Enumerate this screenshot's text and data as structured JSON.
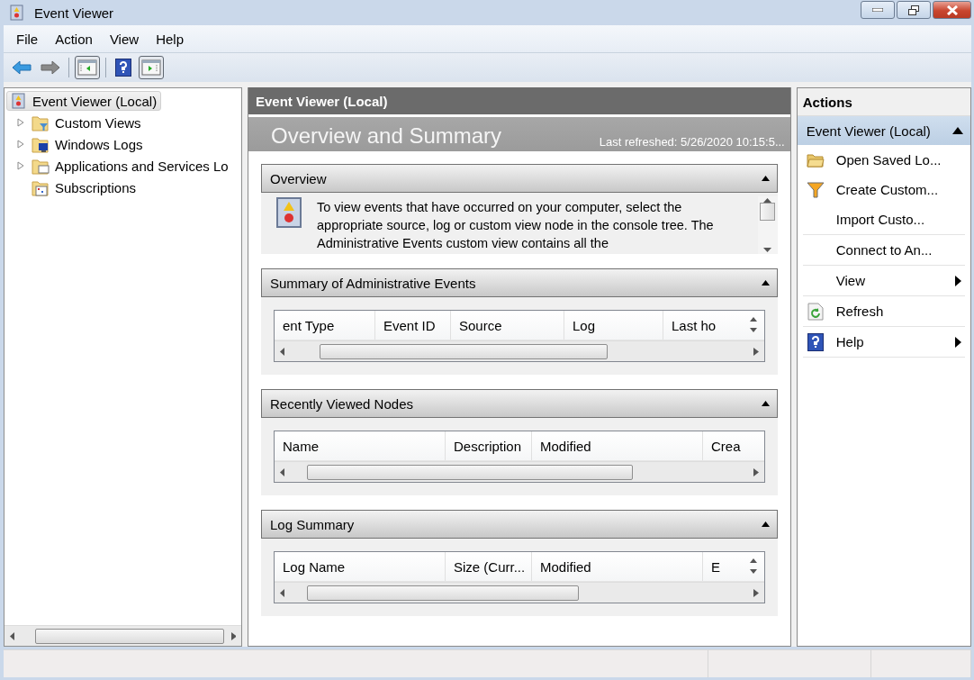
{
  "window": {
    "title": "Event Viewer"
  },
  "menu": [
    {
      "label": "File"
    },
    {
      "label": "Action"
    },
    {
      "label": "View"
    },
    {
      "label": "Help"
    }
  ],
  "tree": {
    "label": "Event Viewer (Local)",
    "selected": true,
    "children": [
      {
        "label": "Custom Views",
        "kind": "filter-folder",
        "expandable": true
      },
      {
        "label": "Windows Logs",
        "kind": "monitor-folder",
        "expandable": true
      },
      {
        "label": "Applications and Services Lo",
        "kind": "window-folder",
        "expandable": true
      },
      {
        "label": "Subscriptions",
        "kind": "calendar",
        "expandable": false
      }
    ]
  },
  "center": {
    "header": "Event Viewer (Local)",
    "banner_title": "Overview and Summary",
    "refreshed": "Last refreshed: 5/26/2020 10:15:5...",
    "sections": [
      {
        "title": "Overview",
        "expanded": true,
        "kind": "text",
        "text": "To view events that have occurred on your computer, select the appropriate source, log or custom view node in the console tree. The Administrative Events custom view contains all the"
      },
      {
        "title": "Summary of Administrative Events",
        "expanded": true,
        "kind": "table",
        "columns": [
          "ent Type",
          "Event ID",
          "Source",
          "Log",
          "Last ho"
        ]
      },
      {
        "title": "Recently Viewed Nodes",
        "expanded": true,
        "kind": "table",
        "columns": [
          "Name",
          "Description",
          "Modified",
          "Crea"
        ]
      },
      {
        "title": "Log Summary",
        "expanded": true,
        "kind": "table",
        "columns": [
          "Log Name",
          "Size (Curr...",
          "Modified",
          "E"
        ]
      }
    ]
  },
  "actions": {
    "title": "Actions",
    "group": {
      "label": "Event Viewer (Local)",
      "expanded": true
    },
    "groups": [
      [
        {
          "label": "Open Saved Lo...",
          "kind": "folder",
          "submenu": false
        },
        {
          "label": "Create Custom...",
          "kind": "filter",
          "submenu": false
        },
        {
          "label": "Import Custo...",
          "kind": "none",
          "submenu": false
        }
      ],
      [
        {
          "label": "Connect to An...",
          "kind": "none",
          "submenu": false
        }
      ],
      [
        {
          "label": "View",
          "kind": "none",
          "submenu": true
        }
      ],
      [
        {
          "label": "Refresh",
          "kind": "refresh",
          "submenu": false
        }
      ],
      [
        {
          "label": "Help",
          "kind": "help",
          "submenu": true
        }
      ]
    ]
  }
}
